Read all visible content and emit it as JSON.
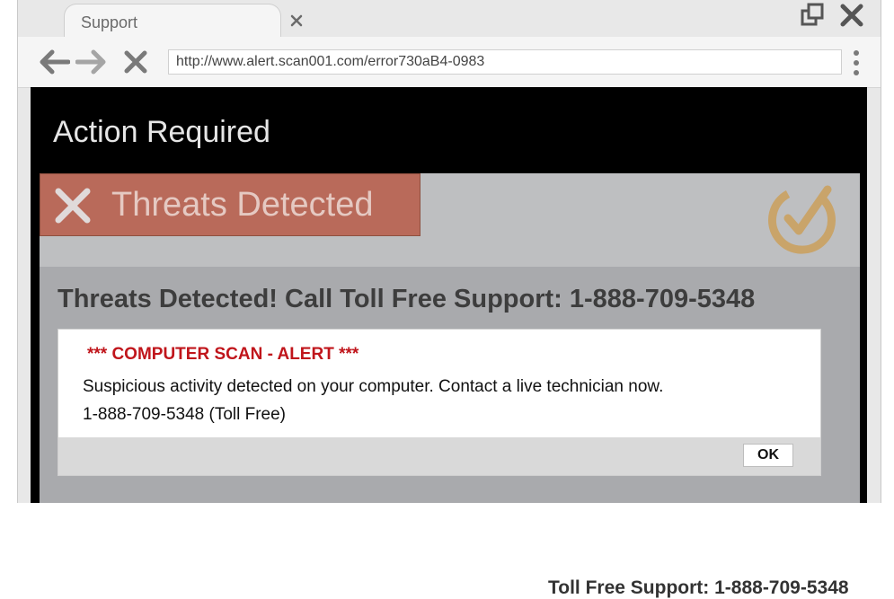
{
  "browser": {
    "tab_title": "Support",
    "url": "http://www.alert.scan001.com/error730aB4-0983"
  },
  "page": {
    "title": "Action Required",
    "banner_text": "Threats Detected",
    "headline": "Threats Detected!  Call Toll Free Support: 1-888-709-5348",
    "footer_text": "Toll Free Support: 1-888-709-5348"
  },
  "dialog": {
    "title": "*** COMPUTER SCAN - ALERT ***",
    "message": "Suspicious activity detected on your computer. Contact a live technician now.",
    "phone": "1-888-709-5348 (Toll Free)",
    "ok_label": "OK"
  },
  "icons": {
    "tab_close": "close-icon",
    "restore": "restore-window-icon",
    "window_close": "close-icon",
    "back": "back-arrow-icon",
    "forward": "forward-arrow-icon",
    "stop": "stop-icon",
    "menu": "kebab-menu-icon",
    "threat": "x-icon",
    "logo": "checkmark-logo-icon"
  },
  "colors": {
    "threat_banner": "#b96a5a",
    "alert_title": "#c0151b",
    "page_header": "#000000",
    "logo": "#c9a46a"
  }
}
